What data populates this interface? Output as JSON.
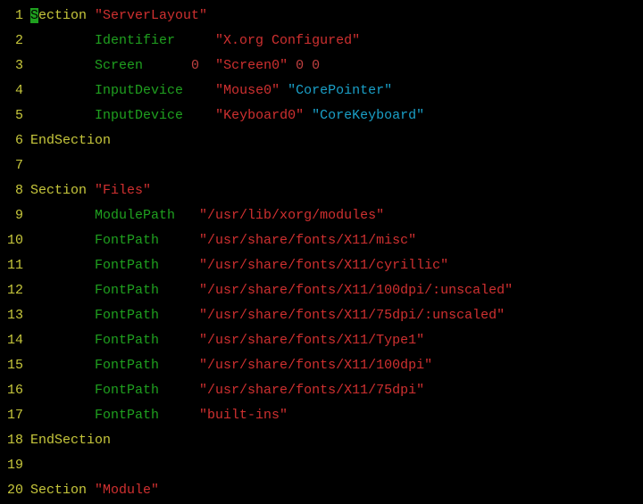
{
  "lines": [
    {
      "n": "1",
      "tokens": [
        [
          "cursor",
          "S"
        ],
        [
          "kw",
          "ection "
        ],
        [
          "str",
          "\"ServerLayout\""
        ]
      ]
    },
    {
      "n": "2",
      "tokens": [
        [
          "",
          "        "
        ],
        [
          "ident",
          "Identifier"
        ],
        [
          "",
          "     "
        ],
        [
          "str",
          "\"X.org Configured\""
        ]
      ]
    },
    {
      "n": "3",
      "tokens": [
        [
          "",
          "        "
        ],
        [
          "ident",
          "Screen"
        ],
        [
          "",
          "      "
        ],
        [
          "num",
          "0"
        ],
        [
          "",
          "  "
        ],
        [
          "str",
          "\"Screen0\""
        ],
        [
          "",
          " "
        ],
        [
          "num",
          "0 0"
        ]
      ]
    },
    {
      "n": "4",
      "tokens": [
        [
          "",
          "        "
        ],
        [
          "ident",
          "InputDevice"
        ],
        [
          "",
          "    "
        ],
        [
          "str",
          "\"Mouse0\""
        ],
        [
          "",
          " "
        ],
        [
          "opt",
          "\"CorePointer\""
        ]
      ]
    },
    {
      "n": "5",
      "tokens": [
        [
          "",
          "        "
        ],
        [
          "ident",
          "InputDevice"
        ],
        [
          "",
          "    "
        ],
        [
          "str",
          "\"Keyboard0\""
        ],
        [
          "",
          " "
        ],
        [
          "opt",
          "\"CoreKeyboard\""
        ]
      ]
    },
    {
      "n": "6",
      "tokens": [
        [
          "kw",
          "EndSection"
        ]
      ]
    },
    {
      "n": "7",
      "tokens": []
    },
    {
      "n": "8",
      "tokens": [
        [
          "kw",
          "Section "
        ],
        [
          "str",
          "\"Files\""
        ]
      ]
    },
    {
      "n": "9",
      "tokens": [
        [
          "",
          "        "
        ],
        [
          "ident",
          "ModulePath"
        ],
        [
          "",
          "   "
        ],
        [
          "str",
          "\"/usr/lib/xorg/modules\""
        ]
      ]
    },
    {
      "n": "10",
      "tokens": [
        [
          "",
          "        "
        ],
        [
          "ident",
          "FontPath"
        ],
        [
          "",
          "     "
        ],
        [
          "str",
          "\"/usr/share/fonts/X11/misc\""
        ]
      ]
    },
    {
      "n": "11",
      "tokens": [
        [
          "",
          "        "
        ],
        [
          "ident",
          "FontPath"
        ],
        [
          "",
          "     "
        ],
        [
          "str",
          "\"/usr/share/fonts/X11/cyrillic\""
        ]
      ]
    },
    {
      "n": "12",
      "tokens": [
        [
          "",
          "        "
        ],
        [
          "ident",
          "FontPath"
        ],
        [
          "",
          "     "
        ],
        [
          "str",
          "\"/usr/share/fonts/X11/100dpi/:unscaled\""
        ]
      ]
    },
    {
      "n": "13",
      "tokens": [
        [
          "",
          "        "
        ],
        [
          "ident",
          "FontPath"
        ],
        [
          "",
          "     "
        ],
        [
          "str",
          "\"/usr/share/fonts/X11/75dpi/:unscaled\""
        ]
      ]
    },
    {
      "n": "14",
      "tokens": [
        [
          "",
          "        "
        ],
        [
          "ident",
          "FontPath"
        ],
        [
          "",
          "     "
        ],
        [
          "str",
          "\"/usr/share/fonts/X11/Type1\""
        ]
      ]
    },
    {
      "n": "15",
      "tokens": [
        [
          "",
          "        "
        ],
        [
          "ident",
          "FontPath"
        ],
        [
          "",
          "     "
        ],
        [
          "str",
          "\"/usr/share/fonts/X11/100dpi\""
        ]
      ]
    },
    {
      "n": "16",
      "tokens": [
        [
          "",
          "        "
        ],
        [
          "ident",
          "FontPath"
        ],
        [
          "",
          "     "
        ],
        [
          "str",
          "\"/usr/share/fonts/X11/75dpi\""
        ]
      ]
    },
    {
      "n": "17",
      "tokens": [
        [
          "",
          "        "
        ],
        [
          "ident",
          "FontPath"
        ],
        [
          "",
          "     "
        ],
        [
          "str",
          "\"built-ins\""
        ]
      ]
    },
    {
      "n": "18",
      "tokens": [
        [
          "kw",
          "EndSection"
        ]
      ]
    },
    {
      "n": "19",
      "tokens": []
    },
    {
      "n": "20",
      "tokens": [
        [
          "kw",
          "Section "
        ],
        [
          "str",
          "\"Module\""
        ]
      ]
    }
  ]
}
